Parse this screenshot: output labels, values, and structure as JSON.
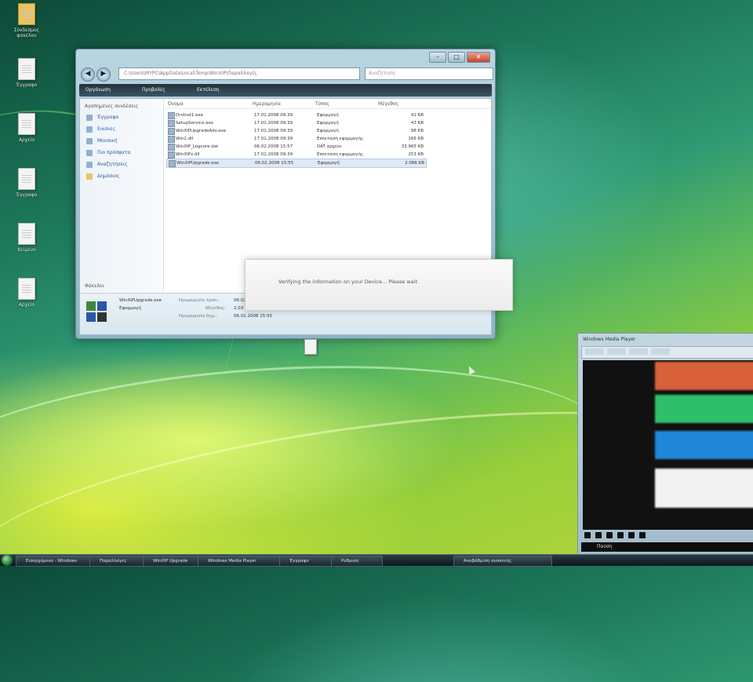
{
  "desktop": {
    "icons": [
      {
        "name": "folder-icon",
        "caption": "Σύνδεσμος φακέλου"
      },
      {
        "name": "document-icon",
        "caption": "Έγγραφο"
      },
      {
        "name": "document-icon",
        "caption": "Αρχείο"
      },
      {
        "name": "document-icon",
        "caption": "Έγγραφο"
      },
      {
        "name": "document-icon",
        "caption": "Κείμενο"
      },
      {
        "name": "document-icon",
        "caption": "Αρχείο"
      }
    ]
  },
  "explorer": {
    "address": "C:\\Users\\MYPC\\AppData\\Local\\Temp\\WinXIP\\Παραλλαγές",
    "search_placeholder": "Αναζήτηση",
    "toolbar": [
      "Οργάνωση",
      "Προβολές",
      "Εκτέλεση"
    ],
    "nav_header": "Αγαπημένες συνδέσεις",
    "nav_items": [
      "Έγγραφα",
      "Εικόνες",
      "Μουσική",
      "Πιο πρόσφατα",
      "Αναζητήσεις",
      "Δημόσιος"
    ],
    "nav_footer": "Φάκελοι",
    "columns": [
      "Όνομα",
      "Ημερομηνία",
      "Τύπος",
      "Μέγεθος"
    ],
    "files": [
      {
        "name": "DrvInst1.exe",
        "date": "17.01.2008 09:39",
        "type": "Εφαρμογή",
        "size": "41 KB"
      },
      {
        "name": "SetupService.exe",
        "date": "17.01.2008 09:39",
        "type": "Εφαρμογή",
        "size": "43 KB"
      },
      {
        "name": "WinXIPUpgradeAdv.exe",
        "date": "17.01.2008 09:39",
        "type": "Εφαρμογή",
        "size": "98 KB"
      },
      {
        "name": "Win2.dll",
        "date": "17.01.2008 09:39",
        "type": "Επέκταση εφαρμογής",
        "size": "166 KB"
      },
      {
        "name": "WinXIP_Logcore.dat",
        "date": "06.02.2008 15:57",
        "type": "DAT αρχείο",
        "size": "33.965 KB"
      },
      {
        "name": "WinXIPx.dll",
        "date": "17.01.2008 09:39",
        "type": "Επέκταση εφαρμογής",
        "size": "253 KB"
      },
      {
        "name": "WinXIPUpgrade.exe",
        "date": "06.02.2008 15:55",
        "type": "Εφαρμογή",
        "size": "2.086 KB"
      }
    ],
    "selected_index": 6,
    "details": {
      "name": "WinXIPUpgrade.exe",
      "type": "Εφαρμογή",
      "modified_label": "Ημερομηνία τροπ.:",
      "modified": "06.02.2008 15:55",
      "size_label": "Μέγεθος:",
      "size": "2,03 MB",
      "created_label": "Ημερομηνία δημ.:",
      "created": "06.02.2008 15:55"
    }
  },
  "notification": {
    "message": "Verifying the information on your Device... Please wait"
  },
  "player": {
    "title": "Windows Media Player",
    "status": "Παύση",
    "bar_colors": [
      "#d8613a",
      "#2fbf6a",
      "#1f86d8",
      "#f2f2f2"
    ]
  },
  "taskbar": {
    "tasks": [
      "Εισερχόμενα - Windows",
      "Παραλλαγές",
      "WinXIP Upgrade",
      "Windows Media Player",
      "Έγγραφο",
      "Ρύθμιση",
      "Αναβάθμιση συσκευής"
    ]
  }
}
